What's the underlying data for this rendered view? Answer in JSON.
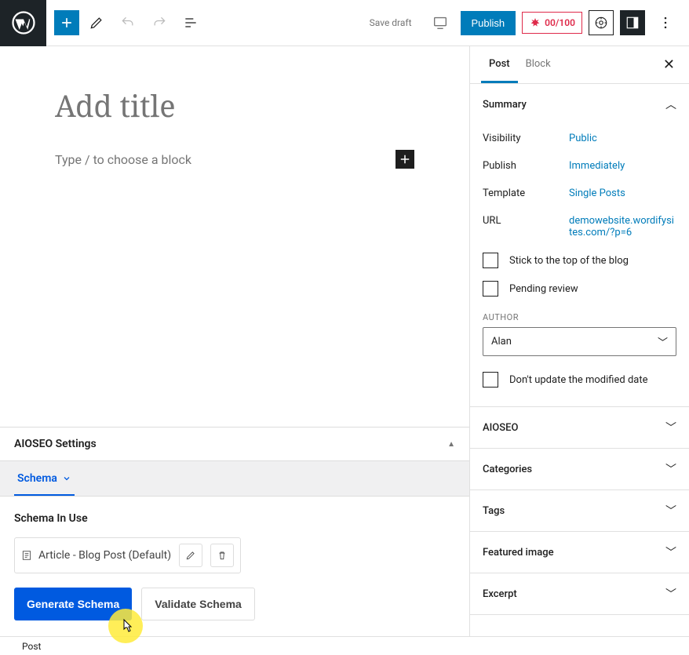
{
  "topbar": {
    "save_draft": "Save draft",
    "publish": "Publish",
    "score": "00/100"
  },
  "editor": {
    "title_placeholder": "Add title",
    "block_placeholder": "Type / to choose a block"
  },
  "aioseo": {
    "header": "AIOSEO Settings",
    "tab_schema": "Schema",
    "schema_in_use": "Schema In Use",
    "schema_default": "Article - Blog Post (Default)",
    "generate": "Generate Schema",
    "validate": "Validate Schema"
  },
  "sidebar": {
    "tabs": {
      "post": "Post",
      "block": "Block"
    },
    "summary": {
      "title": "Summary",
      "visibility": {
        "label": "Visibility",
        "value": "Public"
      },
      "publish": {
        "label": "Publish",
        "value": "Immediately"
      },
      "template": {
        "label": "Template",
        "value": "Single Posts"
      },
      "url": {
        "label": "URL",
        "value": "demowebsite.wordifysites.com/?p=6"
      },
      "stick": "Stick to the top of the blog",
      "pending": "Pending review",
      "author_label": "AUTHOR",
      "author_value": "Alan",
      "dont_update": "Don't update the modified date"
    },
    "sections": {
      "aioseo": "AIOSEO",
      "categories": "Categories",
      "tags": "Tags",
      "featured": "Featured image",
      "excerpt": "Excerpt"
    }
  },
  "footer": {
    "crumb": "Post"
  }
}
